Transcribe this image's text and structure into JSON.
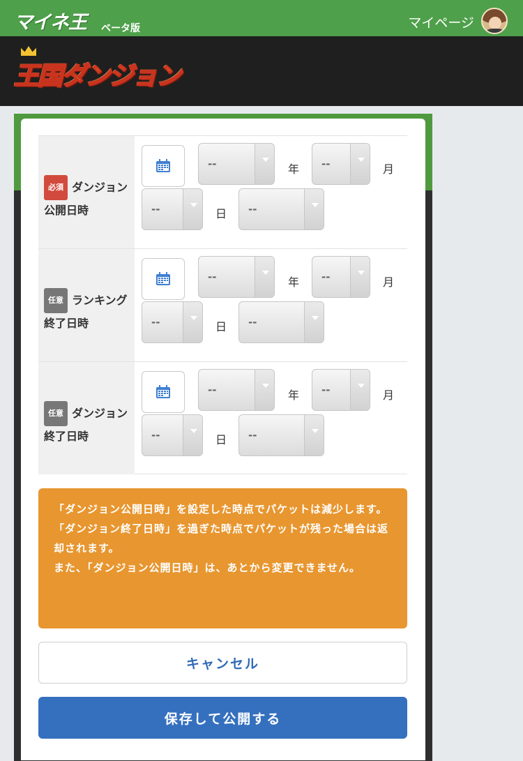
{
  "header": {
    "site_logo": "マイネ王",
    "beta": "ベータ版",
    "mypage": "マイページ"
  },
  "banner": {
    "game_logo": "王国ダンジョン"
  },
  "form": {
    "rows": [
      {
        "badge": "必須",
        "label": "ダンジョン公開日時",
        "year": "--",
        "month": "--",
        "day": "--",
        "time": "--",
        "year_unit": "年",
        "month_unit": "月",
        "day_unit": "日"
      },
      {
        "badge": "任意",
        "label": "ランキング終了日時",
        "year": "--",
        "month": "--",
        "day": "--",
        "time": "--",
        "year_unit": "年",
        "month_unit": "月",
        "day_unit": "日"
      },
      {
        "badge": "任意",
        "label": "ダンジョン終了日時",
        "year": "--",
        "month": "--",
        "day": "--",
        "time": "--",
        "year_unit": "年",
        "month_unit": "月",
        "day_unit": "日"
      }
    ]
  },
  "notice": {
    "line1": "「ダンジョン公開日時」を設定した時点でパケットは減少します。",
    "line2": "「ダンジョン終了日時」を過ぎた時点でパケットが残った場合は返却されます。",
    "line3": "また、「ダンジョン公開日時」は、あとから変更できません。"
  },
  "buttons": {
    "cancel": "キャンセル",
    "save": "保存して公開する"
  },
  "colors": {
    "header_green": "#4ea04a",
    "required_badge": "#d24a3d",
    "optional_badge": "#777777",
    "notice_orange": "#e8962f",
    "primary_blue": "#3570bf"
  }
}
